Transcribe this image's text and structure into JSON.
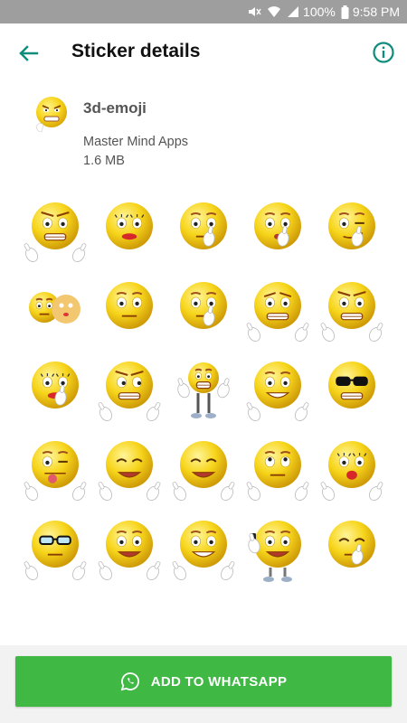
{
  "status_bar": {
    "battery": "100%",
    "time": "9:58 PM"
  },
  "app_bar": {
    "title": "Sticker details",
    "back_icon": "back-arrow-icon",
    "info_icon": "info-icon"
  },
  "pack": {
    "name": "3d-emoji",
    "publisher": "Master Mind Apps",
    "size": "1.6 MB"
  },
  "stickers": [
    {
      "name": "smirk-thumbs-emoji"
    },
    {
      "name": "lipstick-kiss-emoji"
    },
    {
      "name": "thinking-emoji"
    },
    {
      "name": "shush-emoji"
    },
    {
      "name": "wink-emoji"
    },
    {
      "name": "two-faces-emoji"
    },
    {
      "name": "plain-emoji"
    },
    {
      "name": "pondering-emoji"
    },
    {
      "name": "grimace-emoji"
    },
    {
      "name": "angry-grin-emoji"
    },
    {
      "name": "lashes-thinking-emoji"
    },
    {
      "name": "sly-grin-emoji"
    },
    {
      "name": "standing-emoji"
    },
    {
      "name": "laughing-emoji"
    },
    {
      "name": "sunglasses-emoji"
    },
    {
      "name": "tongue-out-emoji"
    },
    {
      "name": "calm-emoji"
    },
    {
      "name": "relaxed-emoji"
    },
    {
      "name": "eye-roll-emoji"
    },
    {
      "name": "surprised-lashes-emoji"
    },
    {
      "name": "glasses-emoji"
    },
    {
      "name": "praying-emoji"
    },
    {
      "name": "big-smile-emoji"
    },
    {
      "name": "phone-call-emoji"
    },
    {
      "name": "hand-over-mouth-emoji"
    }
  ],
  "bottom": {
    "add_label": "ADD TO WHATSAPP",
    "icon": "whatsapp-icon"
  },
  "colors": {
    "accent": "#3fb844",
    "toolbar_icon": "#0e8c7c",
    "status_bar": "#9e9e9e",
    "emoji_yellow": "#f7d51b"
  }
}
